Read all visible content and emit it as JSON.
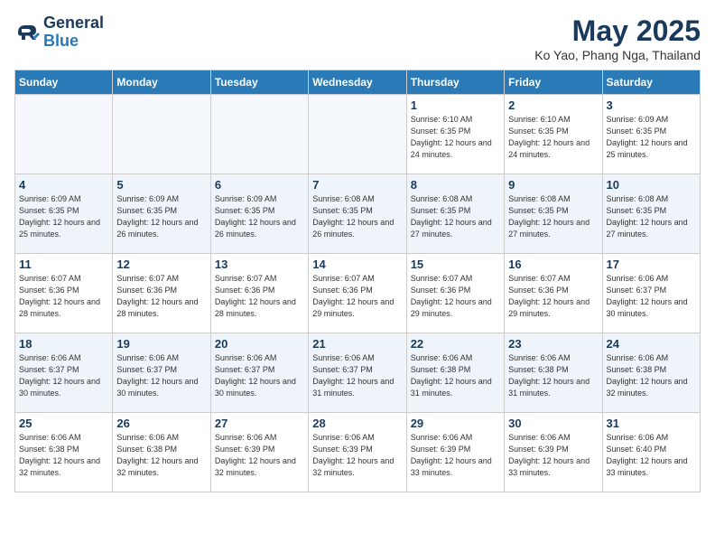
{
  "header": {
    "logo_line1": "General",
    "logo_line2": "Blue",
    "month_year": "May 2025",
    "location": "Ko Yao, Phang Nga, Thailand"
  },
  "days_of_week": [
    "Sunday",
    "Monday",
    "Tuesday",
    "Wednesday",
    "Thursday",
    "Friday",
    "Saturday"
  ],
  "weeks": [
    [
      {
        "day": "",
        "sunrise": "",
        "sunset": "",
        "daylight": ""
      },
      {
        "day": "",
        "sunrise": "",
        "sunset": "",
        "daylight": ""
      },
      {
        "day": "",
        "sunrise": "",
        "sunset": "",
        "daylight": ""
      },
      {
        "day": "",
        "sunrise": "",
        "sunset": "",
        "daylight": ""
      },
      {
        "day": "1",
        "sunrise": "Sunrise: 6:10 AM",
        "sunset": "Sunset: 6:35 PM",
        "daylight": "Daylight: 12 hours and 24 minutes."
      },
      {
        "day": "2",
        "sunrise": "Sunrise: 6:10 AM",
        "sunset": "Sunset: 6:35 PM",
        "daylight": "Daylight: 12 hours and 24 minutes."
      },
      {
        "day": "3",
        "sunrise": "Sunrise: 6:09 AM",
        "sunset": "Sunset: 6:35 PM",
        "daylight": "Daylight: 12 hours and 25 minutes."
      }
    ],
    [
      {
        "day": "4",
        "sunrise": "Sunrise: 6:09 AM",
        "sunset": "Sunset: 6:35 PM",
        "daylight": "Daylight: 12 hours and 25 minutes."
      },
      {
        "day": "5",
        "sunrise": "Sunrise: 6:09 AM",
        "sunset": "Sunset: 6:35 PM",
        "daylight": "Daylight: 12 hours and 26 minutes."
      },
      {
        "day": "6",
        "sunrise": "Sunrise: 6:09 AM",
        "sunset": "Sunset: 6:35 PM",
        "daylight": "Daylight: 12 hours and 26 minutes."
      },
      {
        "day": "7",
        "sunrise": "Sunrise: 6:08 AM",
        "sunset": "Sunset: 6:35 PM",
        "daylight": "Daylight: 12 hours and 26 minutes."
      },
      {
        "day": "8",
        "sunrise": "Sunrise: 6:08 AM",
        "sunset": "Sunset: 6:35 PM",
        "daylight": "Daylight: 12 hours and 27 minutes."
      },
      {
        "day": "9",
        "sunrise": "Sunrise: 6:08 AM",
        "sunset": "Sunset: 6:35 PM",
        "daylight": "Daylight: 12 hours and 27 minutes."
      },
      {
        "day": "10",
        "sunrise": "Sunrise: 6:08 AM",
        "sunset": "Sunset: 6:35 PM",
        "daylight": "Daylight: 12 hours and 27 minutes."
      }
    ],
    [
      {
        "day": "11",
        "sunrise": "Sunrise: 6:07 AM",
        "sunset": "Sunset: 6:36 PM",
        "daylight": "Daylight: 12 hours and 28 minutes."
      },
      {
        "day": "12",
        "sunrise": "Sunrise: 6:07 AM",
        "sunset": "Sunset: 6:36 PM",
        "daylight": "Daylight: 12 hours and 28 minutes."
      },
      {
        "day": "13",
        "sunrise": "Sunrise: 6:07 AM",
        "sunset": "Sunset: 6:36 PM",
        "daylight": "Daylight: 12 hours and 28 minutes."
      },
      {
        "day": "14",
        "sunrise": "Sunrise: 6:07 AM",
        "sunset": "Sunset: 6:36 PM",
        "daylight": "Daylight: 12 hours and 29 minutes."
      },
      {
        "day": "15",
        "sunrise": "Sunrise: 6:07 AM",
        "sunset": "Sunset: 6:36 PM",
        "daylight": "Daylight: 12 hours and 29 minutes."
      },
      {
        "day": "16",
        "sunrise": "Sunrise: 6:07 AM",
        "sunset": "Sunset: 6:36 PM",
        "daylight": "Daylight: 12 hours and 29 minutes."
      },
      {
        "day": "17",
        "sunrise": "Sunrise: 6:06 AM",
        "sunset": "Sunset: 6:37 PM",
        "daylight": "Daylight: 12 hours and 30 minutes."
      }
    ],
    [
      {
        "day": "18",
        "sunrise": "Sunrise: 6:06 AM",
        "sunset": "Sunset: 6:37 PM",
        "daylight": "Daylight: 12 hours and 30 minutes."
      },
      {
        "day": "19",
        "sunrise": "Sunrise: 6:06 AM",
        "sunset": "Sunset: 6:37 PM",
        "daylight": "Daylight: 12 hours and 30 minutes."
      },
      {
        "day": "20",
        "sunrise": "Sunrise: 6:06 AM",
        "sunset": "Sunset: 6:37 PM",
        "daylight": "Daylight: 12 hours and 30 minutes."
      },
      {
        "day": "21",
        "sunrise": "Sunrise: 6:06 AM",
        "sunset": "Sunset: 6:37 PM",
        "daylight": "Daylight: 12 hours and 31 minutes."
      },
      {
        "day": "22",
        "sunrise": "Sunrise: 6:06 AM",
        "sunset": "Sunset: 6:38 PM",
        "daylight": "Daylight: 12 hours and 31 minutes."
      },
      {
        "day": "23",
        "sunrise": "Sunrise: 6:06 AM",
        "sunset": "Sunset: 6:38 PM",
        "daylight": "Daylight: 12 hours and 31 minutes."
      },
      {
        "day": "24",
        "sunrise": "Sunrise: 6:06 AM",
        "sunset": "Sunset: 6:38 PM",
        "daylight": "Daylight: 12 hours and 32 minutes."
      }
    ],
    [
      {
        "day": "25",
        "sunrise": "Sunrise: 6:06 AM",
        "sunset": "Sunset: 6:38 PM",
        "daylight": "Daylight: 12 hours and 32 minutes."
      },
      {
        "day": "26",
        "sunrise": "Sunrise: 6:06 AM",
        "sunset": "Sunset: 6:38 PM",
        "daylight": "Daylight: 12 hours and 32 minutes."
      },
      {
        "day": "27",
        "sunrise": "Sunrise: 6:06 AM",
        "sunset": "Sunset: 6:39 PM",
        "daylight": "Daylight: 12 hours and 32 minutes."
      },
      {
        "day": "28",
        "sunrise": "Sunrise: 6:06 AM",
        "sunset": "Sunset: 6:39 PM",
        "daylight": "Daylight: 12 hours and 32 minutes."
      },
      {
        "day": "29",
        "sunrise": "Sunrise: 6:06 AM",
        "sunset": "Sunset: 6:39 PM",
        "daylight": "Daylight: 12 hours and 33 minutes."
      },
      {
        "day": "30",
        "sunrise": "Sunrise: 6:06 AM",
        "sunset": "Sunset: 6:39 PM",
        "daylight": "Daylight: 12 hours and 33 minutes."
      },
      {
        "day": "31",
        "sunrise": "Sunrise: 6:06 AM",
        "sunset": "Sunset: 6:40 PM",
        "daylight": "Daylight: 12 hours and 33 minutes."
      }
    ]
  ]
}
